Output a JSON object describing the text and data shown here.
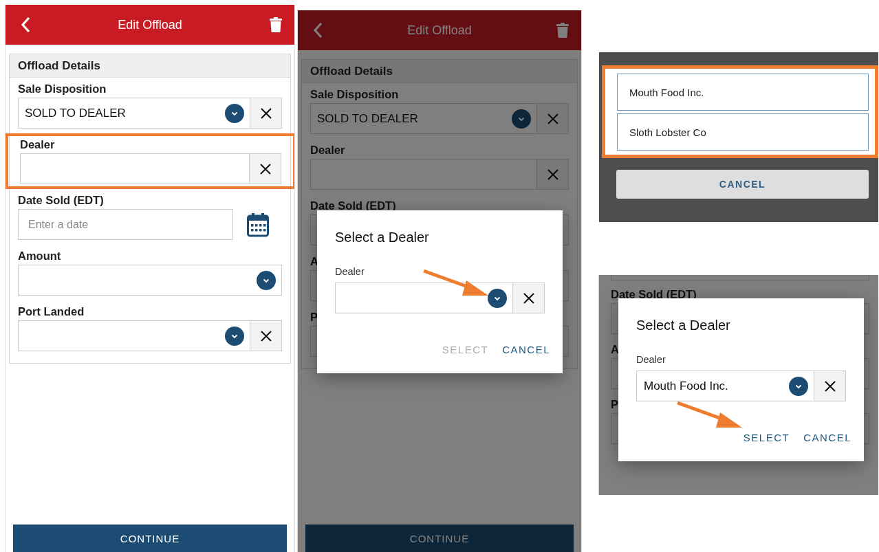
{
  "screens": [
    {
      "title": "Edit Offload",
      "section": "Offload Details",
      "fields": [
        {
          "kind": "select-clear",
          "label": "Sale Disposition",
          "value": "SOLD TO DEALER",
          "highlighted": false
        },
        {
          "kind": "clear",
          "label": "Dealer",
          "highlighted": true
        },
        {
          "kind": "date",
          "label": "Date Sold (EDT)",
          "placeholder": "Enter a date",
          "highlighted": false
        },
        {
          "kind": "select",
          "label": "Amount",
          "highlighted": false
        },
        {
          "kind": "select-clear",
          "label": "Port Landed",
          "highlighted": false
        }
      ],
      "button": "CONTINUE"
    },
    {
      "title": "Edit Offload",
      "section": "Offload Details",
      "fields": [
        {
          "kind": "select-clear",
          "label": "Sale Disposition",
          "value": "SOLD TO DEALER",
          "highlighted": false
        },
        {
          "kind": "clear",
          "label": "Dealer",
          "highlighted": false
        },
        {
          "kind": "peek",
          "label": "Date Sold (EDT)",
          "highlighted": false
        },
        {
          "kind": "peek",
          "label": "A",
          "highlighted": false
        },
        {
          "kind": "peek",
          "label": "P",
          "highlighted": false
        }
      ],
      "button": "CONTINUE",
      "dialog": {
        "title": "Select a Dealer",
        "label": "Dealer",
        "dropdown_pointed": true,
        "select_pointed": false,
        "actions": [
          {
            "label": "SELECT",
            "disabled": true
          },
          {
            "label": "CANCEL",
            "disabled": false
          }
        ]
      }
    }
  ],
  "picker": {
    "options": [
      "Mouth Food Inc.",
      "Sloth Lobster Co"
    ],
    "cancel": "CANCEL"
  },
  "detail": {
    "fields": [
      {
        "label": "Date Sold (EDT)"
      },
      {
        "label": "A"
      },
      {
        "label": "P"
      }
    ],
    "dialog": {
      "title": "Select a Dealer",
      "label": "Dealer",
      "value": "Mouth Food Inc.",
      "dropdown_pointed": false,
      "select_pointed": true,
      "actions": [
        {
          "label": "SELECT",
          "disabled": false
        },
        {
          "label": "CANCEL",
          "disabled": false
        }
      ]
    }
  }
}
